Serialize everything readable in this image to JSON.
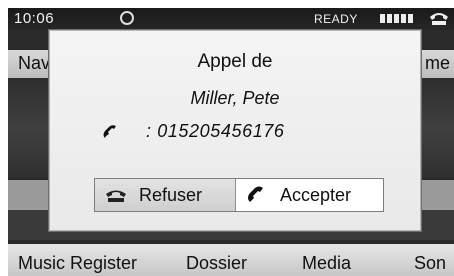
{
  "status": {
    "clock": "10:06",
    "ready": "READY",
    "signal_bars": 5
  },
  "menu": {
    "left_label": "Nav",
    "right_label": "me"
  },
  "dialog": {
    "title": "Appel de",
    "caller_name": "Miller, Pete",
    "number": ": 015205456176",
    "buttons": {
      "refuse_label": "Refuser",
      "accept_label": "Accepter"
    }
  },
  "bottom_tabs": [
    {
      "label": "Music Register"
    },
    {
      "label": "Dossier"
    },
    {
      "label": "Media"
    },
    {
      "label": "Son"
    }
  ],
  "colors": {
    "screen_bg": "#2a2a2a",
    "dialog_bg": "#f0f0f0",
    "accept_bg": "#ffffff",
    "refuse_bg": "#d6d6d6"
  },
  "icons": [
    "gps-icon",
    "signal-icon",
    "phone-status-icon",
    "handset-icon",
    "hang-up-icon",
    "answer-icon"
  ]
}
